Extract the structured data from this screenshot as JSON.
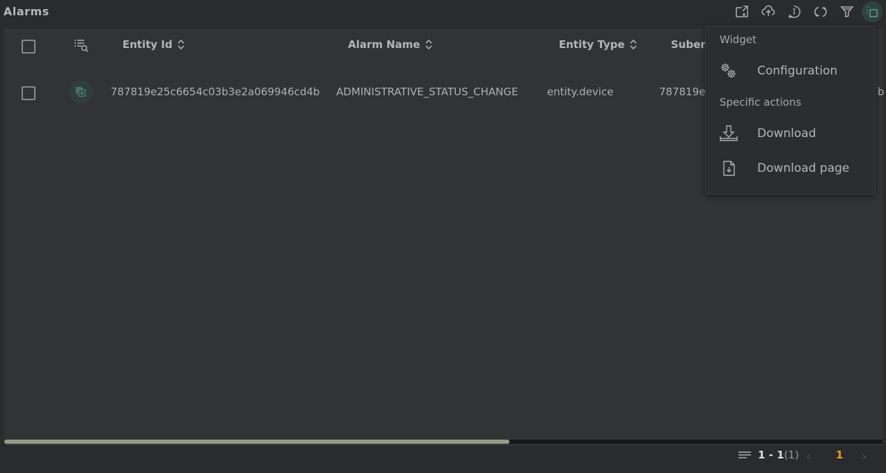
{
  "header": {
    "title": "Alarms",
    "toolbar": [
      {
        "name": "export-widget-icon",
        "label": "Export widget"
      },
      {
        "name": "upload-icon",
        "label": "Upload"
      },
      {
        "name": "info-icon",
        "label": "Info"
      },
      {
        "name": "refresh-icon",
        "label": "Refresh"
      },
      {
        "name": "filter-icon",
        "label": "Filter"
      },
      {
        "name": "select-icon",
        "label": "Selection"
      }
    ]
  },
  "table": {
    "columns": [
      {
        "label": "Entity Id",
        "sortable": true
      },
      {
        "label": "Alarm Name",
        "sortable": true
      },
      {
        "label": "Entity Type",
        "sortable": true
      },
      {
        "label": "Suber",
        "sortable": false
      }
    ],
    "rows": [
      {
        "entity_id": "787819e25c6654c03b3e2a069946cd4b",
        "alarm_name": "ADMINISTRATIVE_STATUS_CHANGE",
        "entity_type": "entity.device",
        "subentity": "787819e",
        "extra": "b"
      }
    ]
  },
  "scroll": {
    "horizontal_thumb_fraction": 0.575
  },
  "pagination": {
    "range": "1 - 1",
    "total": "(1)",
    "current_page": "1",
    "prev": "‹",
    "next": "›"
  },
  "menu": {
    "section_widget": "Widget",
    "configuration": "Configuration",
    "section_specific": "Specific actions",
    "download": "Download",
    "download_page": "Download page"
  },
  "colors": {
    "accent_page": "#f0a020",
    "active_tool_bg": "#304240"
  }
}
